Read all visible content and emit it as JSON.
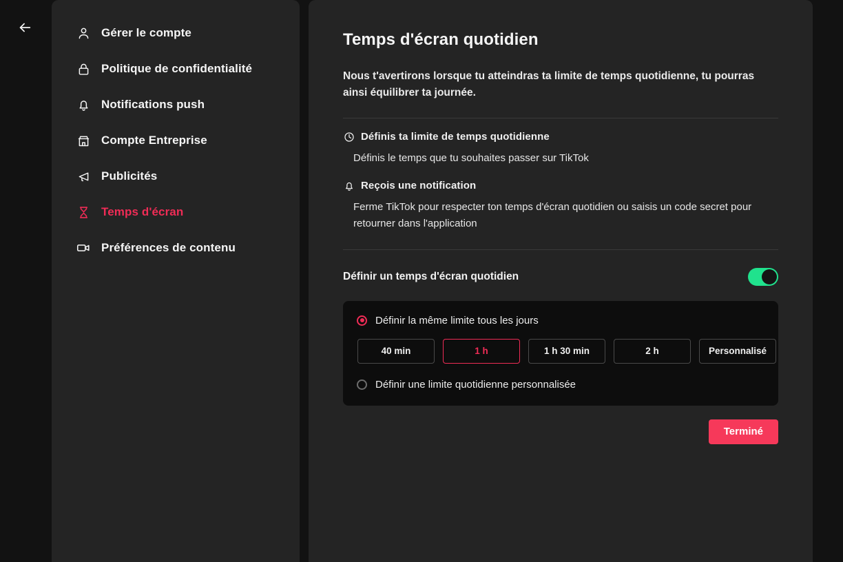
{
  "colors": {
    "background": "#121212",
    "panel": "#242424",
    "card": "#0d0d0d",
    "accent_pink": "#f02c56",
    "done_button": "#f6395a",
    "toggle_on": "#20e28d",
    "text_primary": "#f5f5f5",
    "divider": "#3a3a3a"
  },
  "nav_back": {
    "icon": "arrow-left-icon"
  },
  "sidebar": {
    "items": [
      {
        "label": "Gérer le compte",
        "icon": "person-icon",
        "active": false
      },
      {
        "label": "Politique de confidentialité",
        "icon": "lock-icon",
        "active": false
      },
      {
        "label": "Notifications push",
        "icon": "bell-icon",
        "active": false
      },
      {
        "label": "Compte Entreprise",
        "icon": "storefront-icon",
        "active": false
      },
      {
        "label": "Publicités",
        "icon": "megaphone-icon",
        "active": false
      },
      {
        "label": "Temps d'écran",
        "icon": "hourglass-icon",
        "active": true
      },
      {
        "label": "Préférences de contenu",
        "icon": "video-camera-icon",
        "active": false
      }
    ]
  },
  "main": {
    "title": "Temps d'écran quotidien",
    "description": "Nous t'avertirons lorsque tu atteindras ta limite de temps quotidienne, tu pourras ainsi équilibrer ta journée.",
    "features": [
      {
        "icon": "clock-icon",
        "title": "Définis ta limite de temps quotidienne",
        "body": "Définis le temps que tu souhaites passer sur TikTok"
      },
      {
        "icon": "bell-icon",
        "title": "Reçois une notification",
        "body": "Ferme TikTok pour respecter ton temps d'écran quotidien ou saisis un code secret pour retourner dans l'application"
      }
    ],
    "toggle": {
      "label": "Définir un temps d'écran quotidien",
      "state": "on"
    },
    "limit_card": {
      "same_limit": {
        "label": "Définir la même limite tous les jours",
        "selected": true
      },
      "chips": [
        {
          "label": "40 min",
          "selected": false
        },
        {
          "label": "1 h",
          "selected": true
        },
        {
          "label": "1 h 30 min",
          "selected": false
        },
        {
          "label": "2 h",
          "selected": false
        },
        {
          "label": "Personnalisé",
          "selected": false
        }
      ],
      "custom_limit": {
        "label": "Définir une limite quotidienne personnalisée",
        "selected": false
      }
    },
    "done_label": "Terminé"
  }
}
